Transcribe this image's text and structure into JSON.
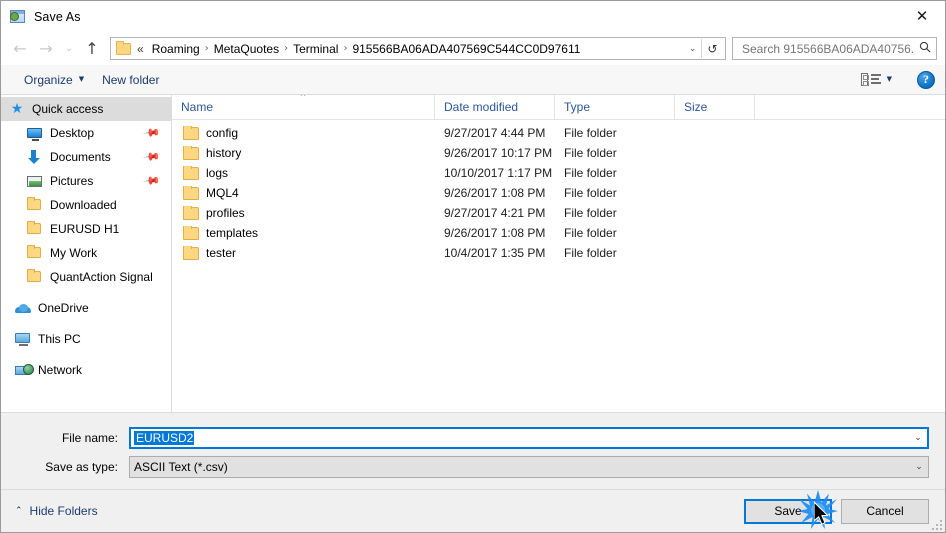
{
  "window": {
    "title": "Save As",
    "icon": "save-as-window-icon",
    "close_label": "✕"
  },
  "nav": {
    "back": "←",
    "forward": "→",
    "recent": "⌄",
    "up": "↑"
  },
  "address": {
    "overflow": "«",
    "crumbs": [
      "Roaming",
      "MetaQuotes",
      "Terminal",
      "915566BA06ADA407569C544CC0D97611"
    ],
    "separator": "›",
    "dropdown": "⌄",
    "refresh": "↺"
  },
  "search": {
    "placeholder": "Search 915566BA06ADA40756...",
    "value": "",
    "icon": "🔍"
  },
  "commandbar": {
    "organize_label": "Organize",
    "organize_caret": "▼",
    "new_folder_label": "New folder",
    "view_caret": "▼",
    "help_label": "?"
  },
  "sidebar": {
    "items": [
      {
        "label": "Quick access",
        "icon": "star-icon",
        "selected": true,
        "pinned": false,
        "indent": false,
        "group": false
      },
      {
        "label": "Desktop",
        "icon": "desktop-icon",
        "selected": false,
        "pinned": true,
        "indent": true,
        "group": false
      },
      {
        "label": "Documents",
        "icon": "documents-icon",
        "selected": false,
        "pinned": true,
        "indent": true,
        "group": false
      },
      {
        "label": "Pictures",
        "icon": "pictures-icon",
        "selected": false,
        "pinned": true,
        "indent": true,
        "group": false
      },
      {
        "label": "Downloaded",
        "icon": "folder-icon",
        "selected": false,
        "pinned": false,
        "indent": true,
        "group": false
      },
      {
        "label": "EURUSD H1",
        "icon": "folder-icon",
        "selected": false,
        "pinned": false,
        "indent": true,
        "group": false
      },
      {
        "label": "My Work",
        "icon": "folder-icon",
        "selected": false,
        "pinned": false,
        "indent": true,
        "group": false
      },
      {
        "label": "QuantAction Signal",
        "icon": "folder-icon",
        "selected": false,
        "pinned": false,
        "indent": true,
        "group": false
      },
      {
        "label": "OneDrive",
        "icon": "onedrive-icon",
        "selected": false,
        "pinned": false,
        "indent": false,
        "group": true
      },
      {
        "label": "This PC",
        "icon": "this-pc-icon",
        "selected": false,
        "pinned": false,
        "indent": false,
        "group": true
      },
      {
        "label": "Network",
        "icon": "network-icon",
        "selected": false,
        "pinned": false,
        "indent": false,
        "group": true
      }
    ],
    "pin_glyph": "📌"
  },
  "filelist": {
    "columns": [
      {
        "label": "Name",
        "sorted": true
      },
      {
        "label": "Date modified",
        "sorted": false
      },
      {
        "label": "Type",
        "sorted": false
      },
      {
        "label": "Size",
        "sorted": false
      }
    ],
    "rows": [
      {
        "name": "config",
        "date": "9/27/2017 4:44 PM",
        "type": "File folder",
        "size": ""
      },
      {
        "name": "history",
        "date": "9/26/2017 10:17 PM",
        "type": "File folder",
        "size": ""
      },
      {
        "name": "logs",
        "date": "10/10/2017 1:17 PM",
        "type": "File folder",
        "size": ""
      },
      {
        "name": "MQL4",
        "date": "9/26/2017 1:08 PM",
        "type": "File folder",
        "size": ""
      },
      {
        "name": "profiles",
        "date": "9/27/2017 4:21 PM",
        "type": "File folder",
        "size": ""
      },
      {
        "name": "templates",
        "date": "9/26/2017 1:08 PM",
        "type": "File folder",
        "size": ""
      },
      {
        "name": "tester",
        "date": "10/4/2017 1:35 PM",
        "type": "File folder",
        "size": ""
      }
    ]
  },
  "form": {
    "filename_label": "File name:",
    "filename_value": "EURUSD2",
    "filetype_label": "Save as type:",
    "filetype_value": "ASCII Text (*.csv)",
    "arrow": "⌄"
  },
  "footer": {
    "hide_folders_label": "Hide Folders",
    "hide_folders_caret": "⌃",
    "save_label": "Save",
    "cancel_label": "Cancel"
  },
  "colors": {
    "accent": "#0078d7",
    "selection": "#0078d7",
    "header_text": "#2b5797",
    "link_text": "#1a3c6e",
    "folder_yellow": "#ffd782"
  }
}
